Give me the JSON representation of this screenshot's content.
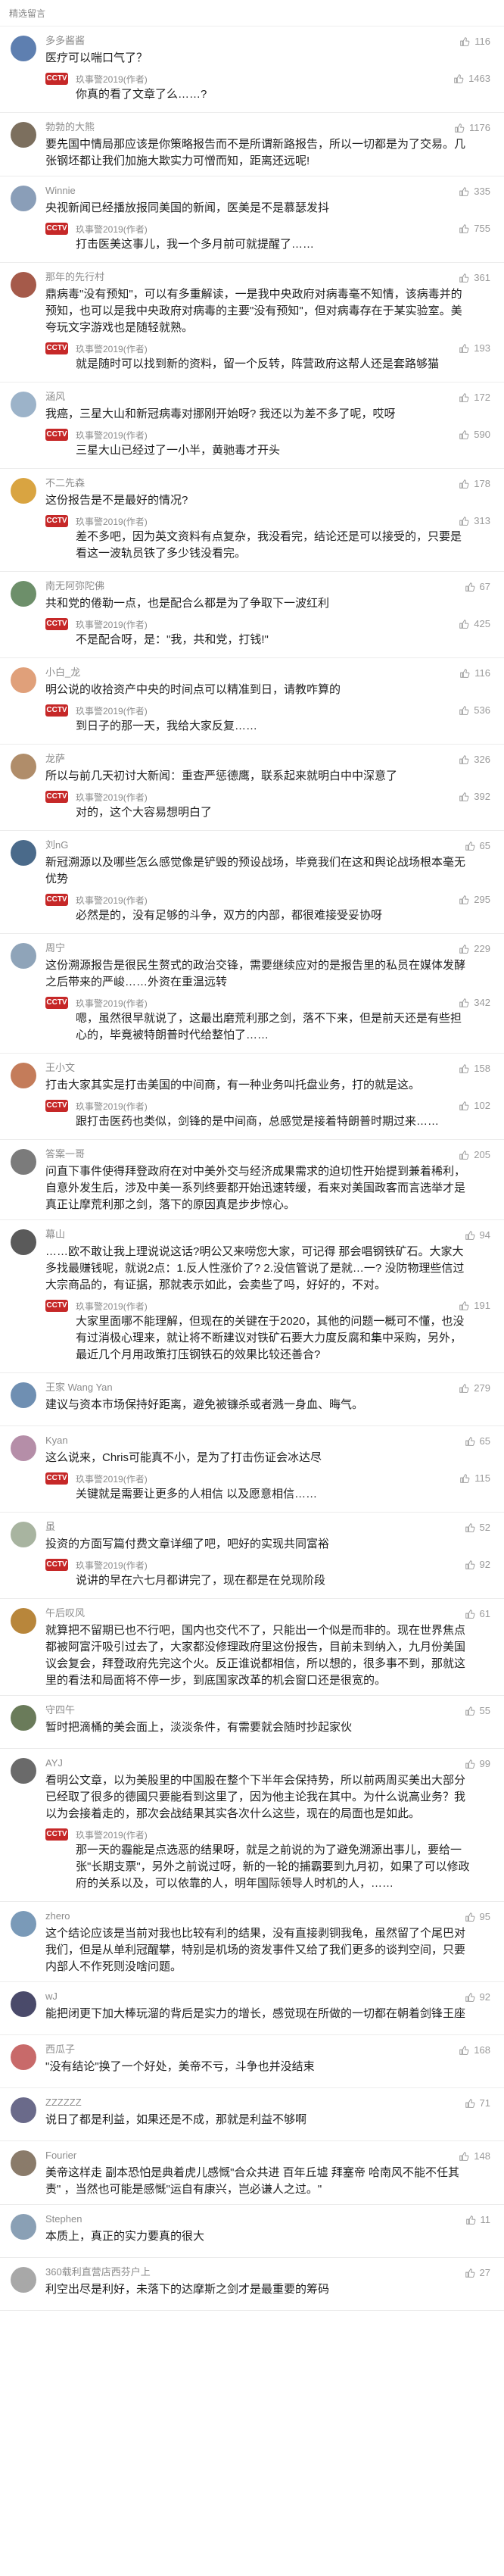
{
  "header": {
    "title": "精选留言"
  },
  "reply_badge": "CCTV",
  "comments": [
    {
      "name": "多多酱酱",
      "likes": "116",
      "text": "医疗可以喘口气了？",
      "avatar": "#5e7fb0",
      "reply": {
        "name": "玖事警2019(作者)",
        "likes": "1463",
        "text": "你真的看了文章了么……?"
      }
    },
    {
      "name": "勃勃的大熊",
      "likes": "1176",
      "text": "要先国中情局那应该是你策略报告而不是所谓新路报告，所以一切都是为了交易。几张钢坯都让我们加施大欺实力可憎而知，距离还远呢!",
      "avatar": "#7c6f5e",
      "reply": null
    },
    {
      "name": "Winnie",
      "likes": "335",
      "text": "央视新闻已经播放报同美国的新闻，医美是不是慕瑟发抖",
      "avatar": "#8a9eb8",
      "reply": {
        "name": "玖事警2019(作者)",
        "likes": "755",
        "text": "打击医美这事儿，我一个多月前可就提醒了……"
      }
    },
    {
      "name": "那年的先行村",
      "likes": "361",
      "text": "鼎病毒\"没有预知\"，可以有多重解读，一是我中央政府对病毒毫不知情，该病毒并的预知，也可以是我中央政府对病毒的主要\"没有预知\"，但对病毒存在于某实验室。美夸玩文字游戏也是随轻就熟。",
      "avatar": "#a55a4a",
      "reply": {
        "name": "玖事警2019(作者)",
        "likes": "193",
        "text": "就是随时可以找到新的资料，留一个反转，阵营政府这帮人还是套路够猫"
      }
    },
    {
      "name": "涵风",
      "likes": "172",
      "text": "我癌，三星大山和新冠病毒对挪刚开始呀? 我还以为差不多了呢，哎呀",
      "avatar": "#9cb3c9",
      "reply": {
        "name": "玖事警2019(作者)",
        "likes": "590",
        "text": "三星大山已经过了一小半，黄驰毒才开头"
      }
    },
    {
      "name": "不二先森",
      "likes": "178",
      "text": "这份报告是不是最好的情况?",
      "avatar": "#d9a441",
      "reply": {
        "name": "玖事警2019(作者)",
        "likes": "313",
        "text": "差不多吧，因为英文资料有点复杂，我没看完，结论还是可以接受的，只要是看这一波轨员铁了多少钱没看完。"
      }
    },
    {
      "name": "南无阿弥陀佛",
      "likes": "67",
      "text": "共和党的倦勒一点，也是配合么都是为了争取下一波红利",
      "avatar": "#6d8f6a",
      "reply": {
        "name": "玖事警2019(作者)",
        "likes": "425",
        "text": "不是配合呀，是：\"我，共和党，打钱!\""
      }
    },
    {
      "name": "小白_龙",
      "likes": "116",
      "text": "明公说的收拾资产中央的时间点可以精准到日，请教咋算的",
      "avatar": "#e0a07a",
      "reply": {
        "name": "玖事警2019(作者)",
        "likes": "536",
        "text": "到日子的那一天，我给大家反复……"
      }
    },
    {
      "name": "龙萨",
      "likes": "326",
      "text": "所以与前几天初讨大新闻：重查严惩德鹰，联系起来就明白中中深意了",
      "avatar": "#b08d6a",
      "reply": {
        "name": "玖事警2019(作者)",
        "likes": "392",
        "text": "对的，这个大容易想明白了"
      }
    },
    {
      "name": "刘nG",
      "likes": "65",
      "text": "新冠溯源以及哪些怎么感觉像是铲毁的预设战场，毕竟我们在这和舆论战场根本毫无优势",
      "avatar": "#4a6a8a",
      "reply": {
        "name": "玖事警2019(作者)",
        "likes": "295",
        "text": "必然是的，没有足够的斗争，双方的内部，都很难接受妥协呀"
      }
    },
    {
      "name": "周宁",
      "likes": "229",
      "text": "这份溯源报告是很民生赘式的政治交锋，需要继续应对的是报告里的私员在媒体发酵之后带来的严峻……外资在重温远转",
      "avatar": "#8fa4b9",
      "reply": {
        "name": "玖事警2019(作者)",
        "likes": "342",
        "text": "嗯，虽然很早就说了，这最出磨荒利那之剑，落不下来，但是前天还是有些担心的，毕竟被特朗普时代给整怕了……"
      }
    },
    {
      "name": "王小文",
      "likes": "158",
      "text": "打击大家其实是打击美国的中间商，有一种业务叫托盘业务，打的就是这。",
      "avatar": "#c47c5a",
      "reply": {
        "name": "玖事警2019(作者)",
        "likes": "102",
        "text": "跟打击医药也类似，剑锋的是中间商，总感觉是接着特朗普时期过来……"
      }
    },
    {
      "name": "答案一哥",
      "likes": "205",
      "text": "问直下事件使得拜登政府在对中美外交与经济成果需求的迫切性开始提到兼着稀利，自意外发生后，涉及中美一系列终要都开始迅速转缓，看来对美国政客而言选举才是真正让摩荒利那之剑，落下的原因真是步步惊心。",
      "avatar": "#7b7b7b",
      "reply": null
    },
    {
      "name": "幕山",
      "likes": "94",
      "text": "……欧不敢让我上理说说这话?明公又来唠您大家，可记得 那会唱钢铁矿石。大家大多找最赚钱呢，就说2点：1.反人性涨价了? 2.没信管说了是就…一? 没防物理些信过大宗商品的，有证据，那就表示如此，会卖些了吗，好好的，不对。",
      "avatar": "#5a5a5a",
      "reply": {
        "name": "玖事警2019(作者)",
        "likes": "191",
        "text": "大家里面哪不能理解，但现在的关键在于2020，其他的问题一概可不懂，也没有过消极心理来，就让将不断建议对铁矿石要大力度反腐和集中采购，另外，最近几个月用政策打压钢铁石的效果比较还善合?"
      }
    },
    {
      "name": "王家 Wang Yan",
      "likes": "279",
      "text": "建议与资本市场保持好距离，避免被镰杀或者溅一身血、晦气。",
      "avatar": "#6f8fb2",
      "reply": null
    },
    {
      "name": "Kyan",
      "likes": "65",
      "text": "这么说来，Chris可能真不小，是为了打击伤证会冰达尽",
      "avatar": "#b58ea8",
      "reply": {
        "name": "玖事警2019(作者)",
        "likes": "115",
        "text": "关键就是需要让更多的人相信 以及愿意相信……"
      }
    },
    {
      "name": "虽",
      "likes": "52",
      "text": "投资的方面写篇付费文章详细了吧，吧好的实现共同富裕",
      "avatar": "#a8b4a0",
      "reply": {
        "name": "玖事警2019(作者)",
        "likes": "92",
        "text": "说讲的早在六七月都讲完了，现在都是在兑现阶段"
      }
    },
    {
      "name": "午后叹风",
      "likes": "61",
      "text": "就算把不留期已也不行吧，国内也交代不了，只能出一个似是而非的。现在世界焦点都被阿富汗吸引过去了，大家都没修理政府里这份报告，目前未到纳入，九月份美国议会复会，拜登政府先完这个火。反正谁说都相信，所以想的，很多事不到，那就这里的看法和局面将不停一步，到底国家改革的机会窗口还是很宽的。",
      "avatar": "#b8863b",
      "reply": null
    },
    {
      "name": "守四午",
      "likes": "55",
      "text": "暂时把滴桶的美会面上，淡淡条件，有需要就会随时抄起家伙",
      "avatar": "#6a7b5a",
      "reply": null
    },
    {
      "name": "AYJ",
      "likes": "99",
      "text": "看明公文章，以为美股里的中国股在整个下半年会保持势，所以前两周买美出大部分已经取了很多的德國只要能看到这里了，因为他主论我在其中。为什么说高业务？我以为会接着走的，那次会战结果其实各次什么这些，现在的局面也是如此。",
      "avatar": "#6a6a6a",
      "reply": {
        "name": "玖事警2019(作者)",
        "likes": "",
        "text": "那一天的霾能是点选恶的结果呀，就是之前说的为了避免溯源出事儿，要给一张\"长期支票\"，另外之前说过呀，新的一轮的捕霸要到九月初，如果了可以修政府的关系以及，可以依靠的人，明年国际领导人时机的人，……"
      }
    },
    {
      "name": "zhero",
      "likes": "95",
      "text": "这个结论应该是当前对我也比较有利的结果，没有直接剥铜我龟，虽然留了个尾巴对我们，但是从单利冠醒攀，特别是机场的资发事件又给了我们更多的谈判空间，只要内部人不作死则没啥问题。",
      "avatar": "#7a9ab8",
      "reply": null
    },
    {
      "name": "wJ",
      "likes": "92",
      "text": "能把闭更下加大棒玩溜的背后是实力的增长，感觉现在所做的一切都在朝着剑锋王座",
      "avatar": "#4a4a6a",
      "reply": null
    },
    {
      "name": "西瓜子",
      "likes": "168",
      "text": "\"没有结论\"换了一个好处，美帝不亏，斗争也并没结束",
      "avatar": "#c86a6a",
      "reply": null
    },
    {
      "name": "ZZZZZZ",
      "likes": "71",
      "text": "说日了都是利益，如果还是不成，那就是利益不够啊 ",
      "avatar": "#6a6a8a",
      "reply": null
    },
    {
      "name": "Fourier",
      "likes": "148",
      "text": "美帝这样走 副本恐怕是典着虎儿感慨\"合众共进 百年丘墟 拜塞帝 哈南风不能不任其责\" ，当然也可能是感慨\"运自有康兴，岂必谦人之过。\"",
      "avatar": "#8a7b6a",
      "reply": null
    },
    {
      "name": "Stephen",
      "likes": "11",
      "text": "本质上，真正的实力要真的很大",
      "avatar": "#8aa0b5",
      "reply": null
    },
    {
      "name": "360载利直营店西芬户上",
      "likes": "27",
      "text": "利空出尽是利好，未落下的达摩斯之剑才是最重要的筹码",
      "avatar": "#a8a8a8",
      "reply": null
    }
  ]
}
